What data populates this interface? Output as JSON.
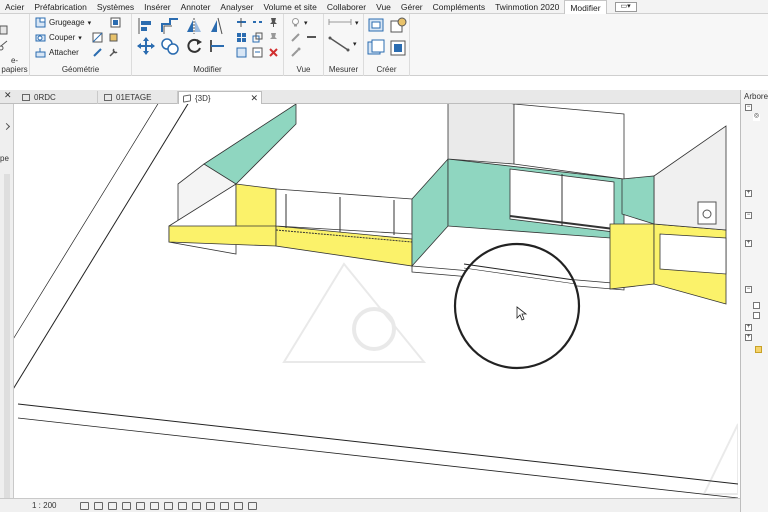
{
  "menubar": {
    "items": [
      "Acier",
      "Préfabrication",
      "Systèmes",
      "Insérer",
      "Annoter",
      "Analyser",
      "Volume et site",
      "Collaborer",
      "Vue",
      "Gérer",
      "Compléments",
      "Twinmotion 2020",
      "Modifier"
    ],
    "active": "Modifier"
  },
  "ribbon": {
    "panels": {
      "presse_papiers": "e-papiers",
      "geometrie": "Géométrie",
      "modifier": "Modifier",
      "vue": "Vue",
      "mesurer": "Mesurer",
      "creer": "Créer"
    },
    "geometrie_buttons": {
      "grugeage": "Grugeage",
      "couper": "Couper",
      "attacher": "Attacher"
    },
    "accent": "#2b6cb0"
  },
  "tabs": [
    {
      "label": "0RDC"
    },
    {
      "label": "01ETAGE"
    },
    {
      "label": "{3D}"
    }
  ],
  "left_panel": {
    "label": "pe"
  },
  "right_panel": {
    "title": "Arbore"
  },
  "statusbar": {
    "scale": "1 : 200"
  },
  "colors": {
    "wall_yellow": "#fbf26a",
    "wall_teal": "#8fd6c0",
    "line": "#222222"
  }
}
